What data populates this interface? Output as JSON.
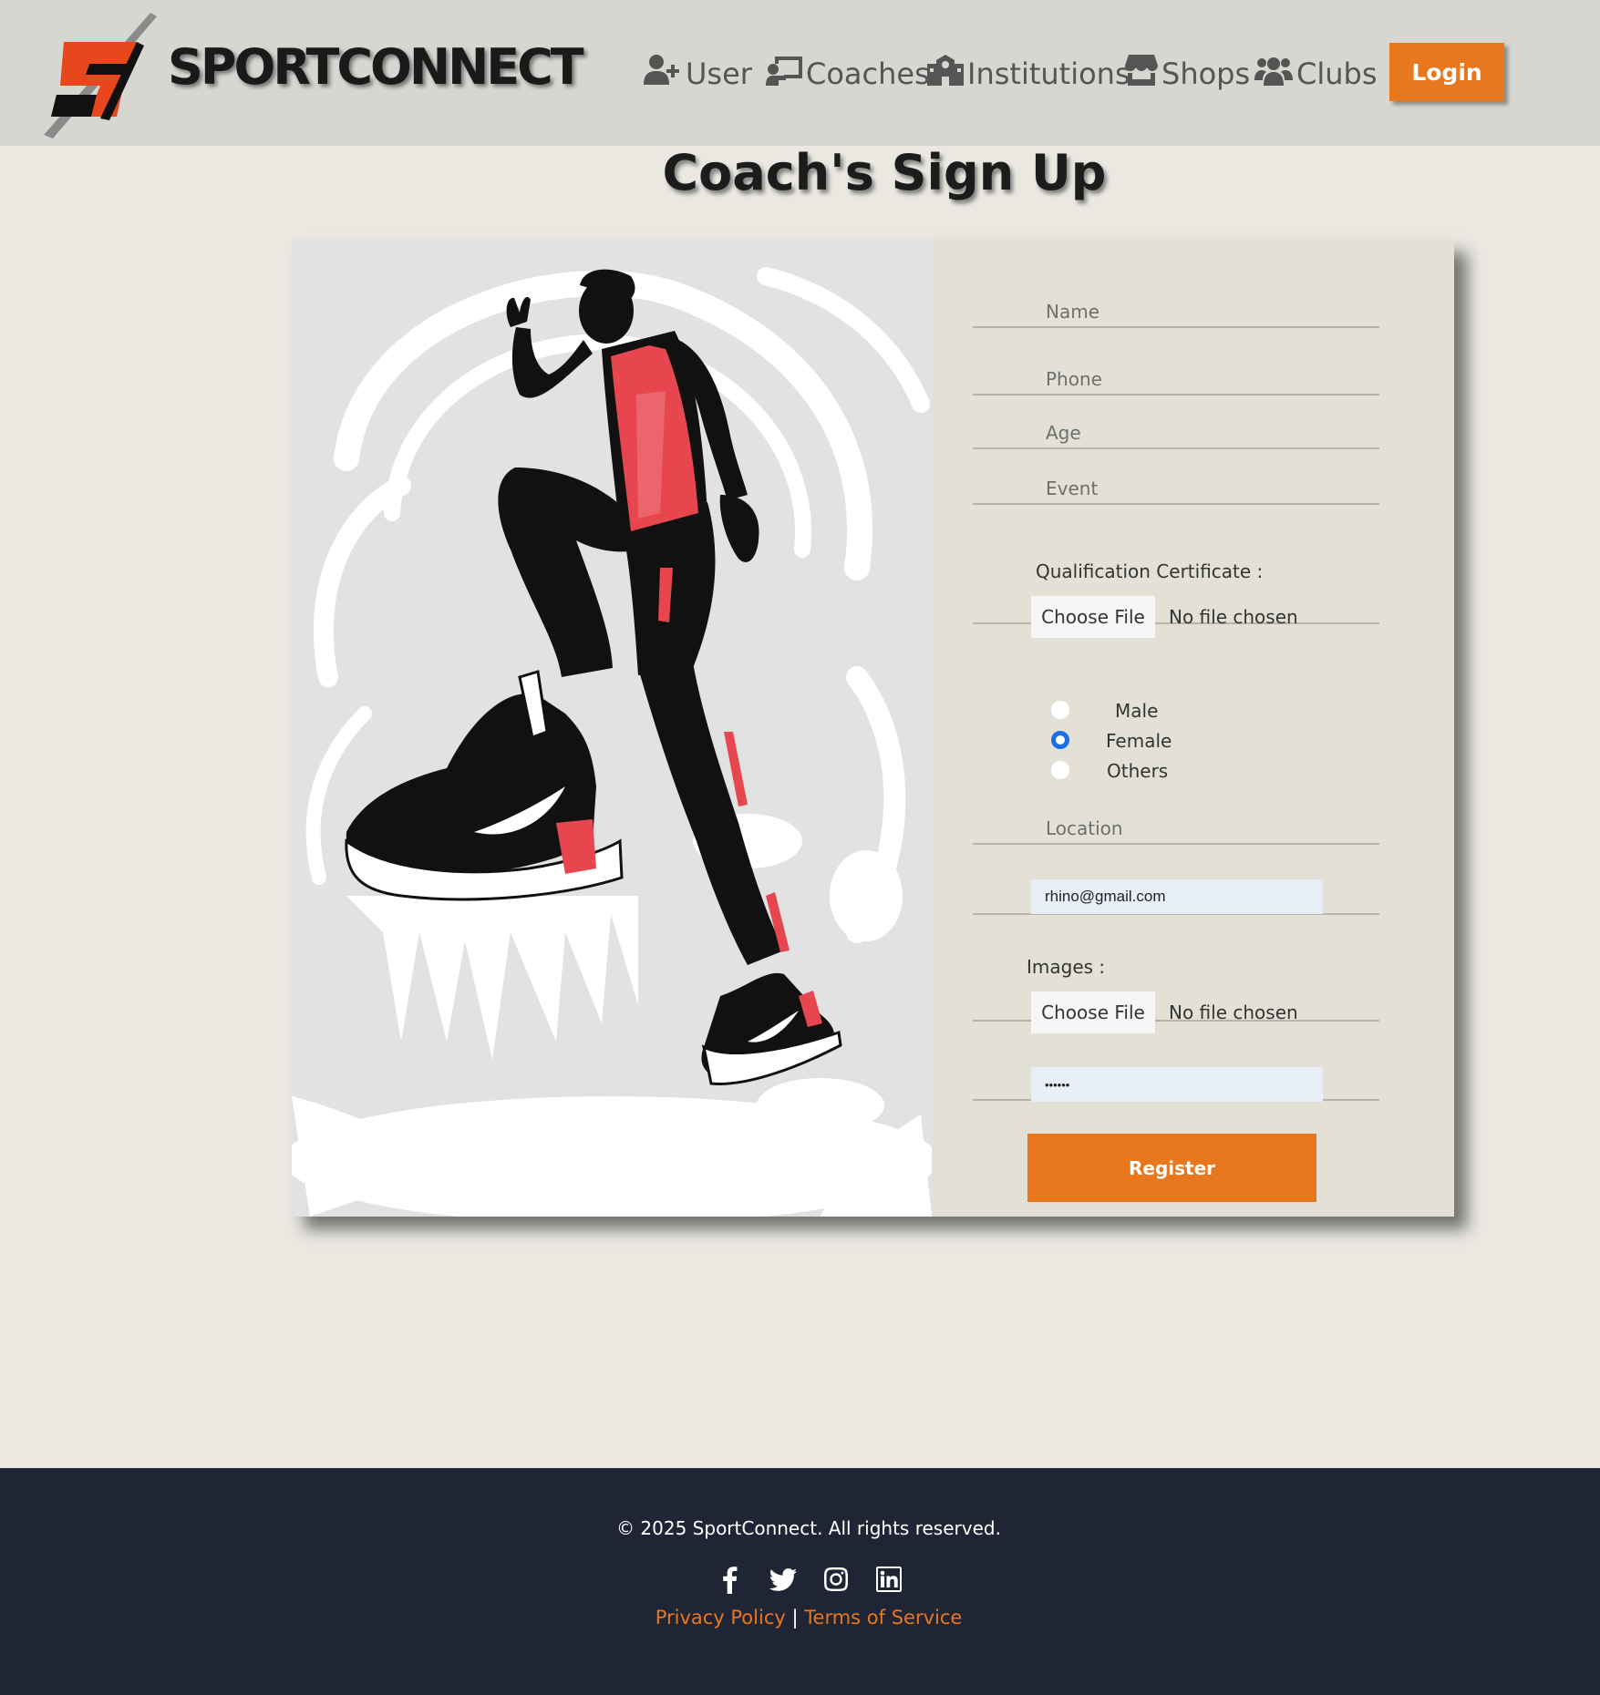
{
  "header": {
    "brand": "SPORTCONNECT",
    "nav": [
      {
        "label": " User",
        "icon": "user-plus-icon"
      },
      {
        "label": "Coaches",
        "icon": "chalkboard-teacher-icon"
      },
      {
        "label": "Institutions",
        "icon": "school-icon"
      },
      {
        "label": "Shops",
        "icon": "store-icon"
      },
      {
        "label": "Clubs",
        "icon": "users-icon"
      }
    ],
    "login_label": "Login"
  },
  "page": {
    "title": "Coach's Sign Up"
  },
  "form": {
    "name_placeholder": "Name",
    "phone_placeholder": "Phone",
    "age_placeholder": "Age",
    "event_placeholder": "Event",
    "certificate_label": "Qualification Certificate :",
    "choose_file_label": "Choose File",
    "no_file_text": "No file chosen",
    "gender_options": [
      "Male",
      "Female",
      "Others"
    ],
    "gender_selected": "Female",
    "location_placeholder": "Location",
    "email_value": "rhino@gmail.com",
    "images_label": "Images :",
    "password_value": "••••••",
    "register_label": "Register"
  },
  "footer": {
    "copyright": "© 2025 SportConnect. All rights reserved.",
    "social_icons": [
      "facebook-icon",
      "twitter-icon",
      "instagram-icon",
      "linkedin-icon"
    ],
    "privacy_label": "Privacy Policy",
    "separator": "|",
    "terms_label": "Terms of Service"
  },
  "colors": {
    "accent": "#e8771e",
    "navbar_bg": "#d8d6d0",
    "page_bg": "#eae8e1",
    "card_bg": "#e3e1d5",
    "footer_bg": "#1f2535",
    "radio_checked": "#1a6fe8",
    "jersey": "#e8464f"
  }
}
